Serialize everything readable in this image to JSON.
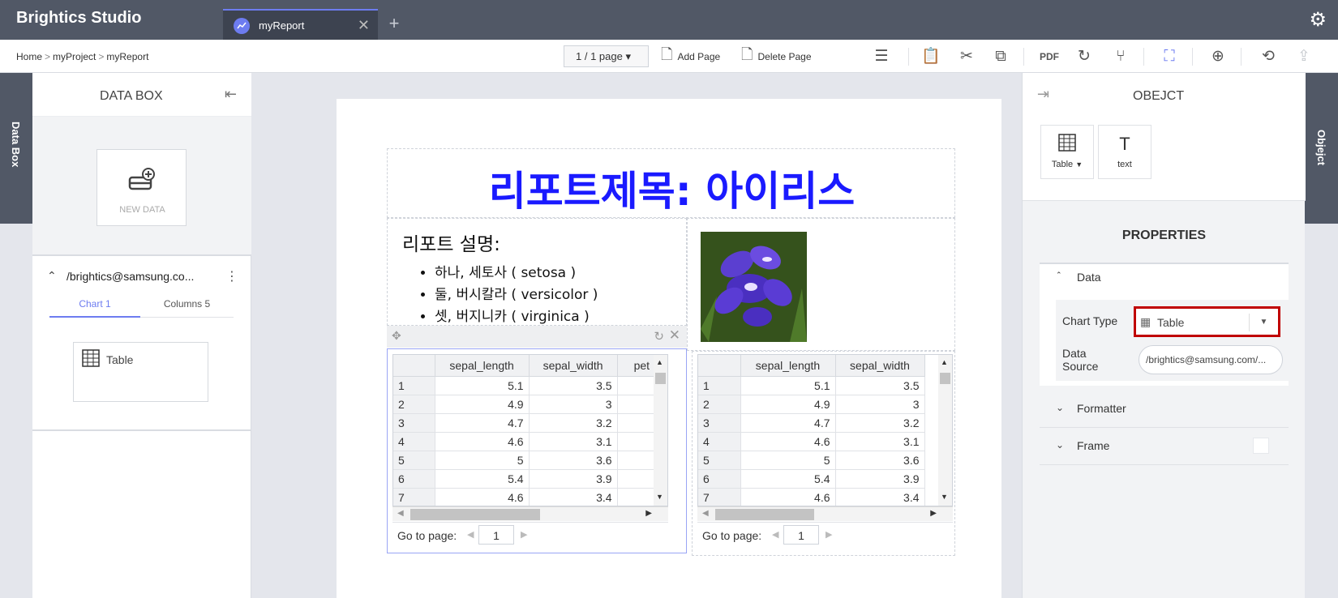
{
  "app": {
    "title": "Brightics Studio"
  },
  "tabs": [
    {
      "label": "myReport",
      "close": "✕"
    }
  ],
  "tab_add": "+",
  "breadcrumb": [
    "Home",
    "myProject",
    "myReport"
  ],
  "breadcrumb_sep": ">",
  "toolbar": {
    "page_select": "1 / 1 page",
    "add_page": "Add Page",
    "delete_page": "Delete Page"
  },
  "left_side_tab": "Data Box",
  "right_side_tab": "Objejct",
  "data_box": {
    "title": "DATA BOX",
    "new_data": "NEW DATA",
    "source": "/brightics@samsung.co...",
    "tabs": [
      "Chart 1",
      "Columns 5"
    ],
    "chart_item": "Table"
  },
  "report": {
    "title": "리포트제목: 아이리스",
    "description_title": "리포트 설명:",
    "description_items": [
      "하나, 세토사 ( setosa )",
      "둘, 버시칼라 ( versicolor )",
      "셋, 버지니카 ( virginica )"
    ]
  },
  "table_left": {
    "columns": [
      "",
      "sepal_length",
      "sepal_width",
      "pet"
    ],
    "rows": [
      [
        "1",
        "5.1",
        "3.5",
        ""
      ],
      [
        "2",
        "4.9",
        "3",
        ""
      ],
      [
        "3",
        "4.7",
        "3.2",
        ""
      ],
      [
        "4",
        "4.6",
        "3.1",
        ""
      ],
      [
        "5",
        "5",
        "3.6",
        ""
      ],
      [
        "6",
        "5.4",
        "3.9",
        ""
      ],
      [
        "7",
        "4.6",
        "3.4",
        ""
      ]
    ],
    "goto_label": "Go to page:",
    "goto_value": "1"
  },
  "table_right": {
    "columns": [
      "",
      "sepal_length",
      "sepal_width"
    ],
    "rows": [
      [
        "1",
        "5.1",
        "3.5"
      ],
      [
        "2",
        "4.9",
        "3"
      ],
      [
        "3",
        "4.7",
        "3.2"
      ],
      [
        "4",
        "4.6",
        "3.1"
      ],
      [
        "5",
        "5",
        "3.6"
      ],
      [
        "6",
        "5.4",
        "3.9"
      ],
      [
        "7",
        "4.6",
        "3.4"
      ]
    ],
    "goto_label": "Go to page:",
    "goto_value": "1"
  },
  "object_panel": {
    "title": "OBEJCT",
    "tiles": [
      "Table",
      "text"
    ],
    "properties_title": "PROPERTIES",
    "sections": [
      "Data",
      "Formatter",
      "Frame"
    ],
    "chart_type_label": "Chart Type",
    "chart_type_value": "Table",
    "data_source_label": "Data Source",
    "data_source_value": "/brightics@samsung.com/..."
  },
  "colors": {
    "accent": "#6d7cf0",
    "title_blue": "#1a1aff",
    "highlight_red": "#c00000",
    "topbar": "#515866"
  },
  "icons": [
    "gear-icon",
    "chart-line-icon",
    "close-icon",
    "plus-icon",
    "add-page-icon",
    "delete-page-icon",
    "report-settings-icon",
    "paste-icon",
    "cut-icon",
    "copy-icon",
    "pdf-icon",
    "refresh-icon",
    "branch-icon",
    "fit-icon",
    "zoom-in-icon",
    "undo-icon",
    "export-icon",
    "table-icon",
    "text-icon",
    "database-add-icon",
    "more-icon",
    "collapse-left-icon",
    "expand-right-icon"
  ]
}
